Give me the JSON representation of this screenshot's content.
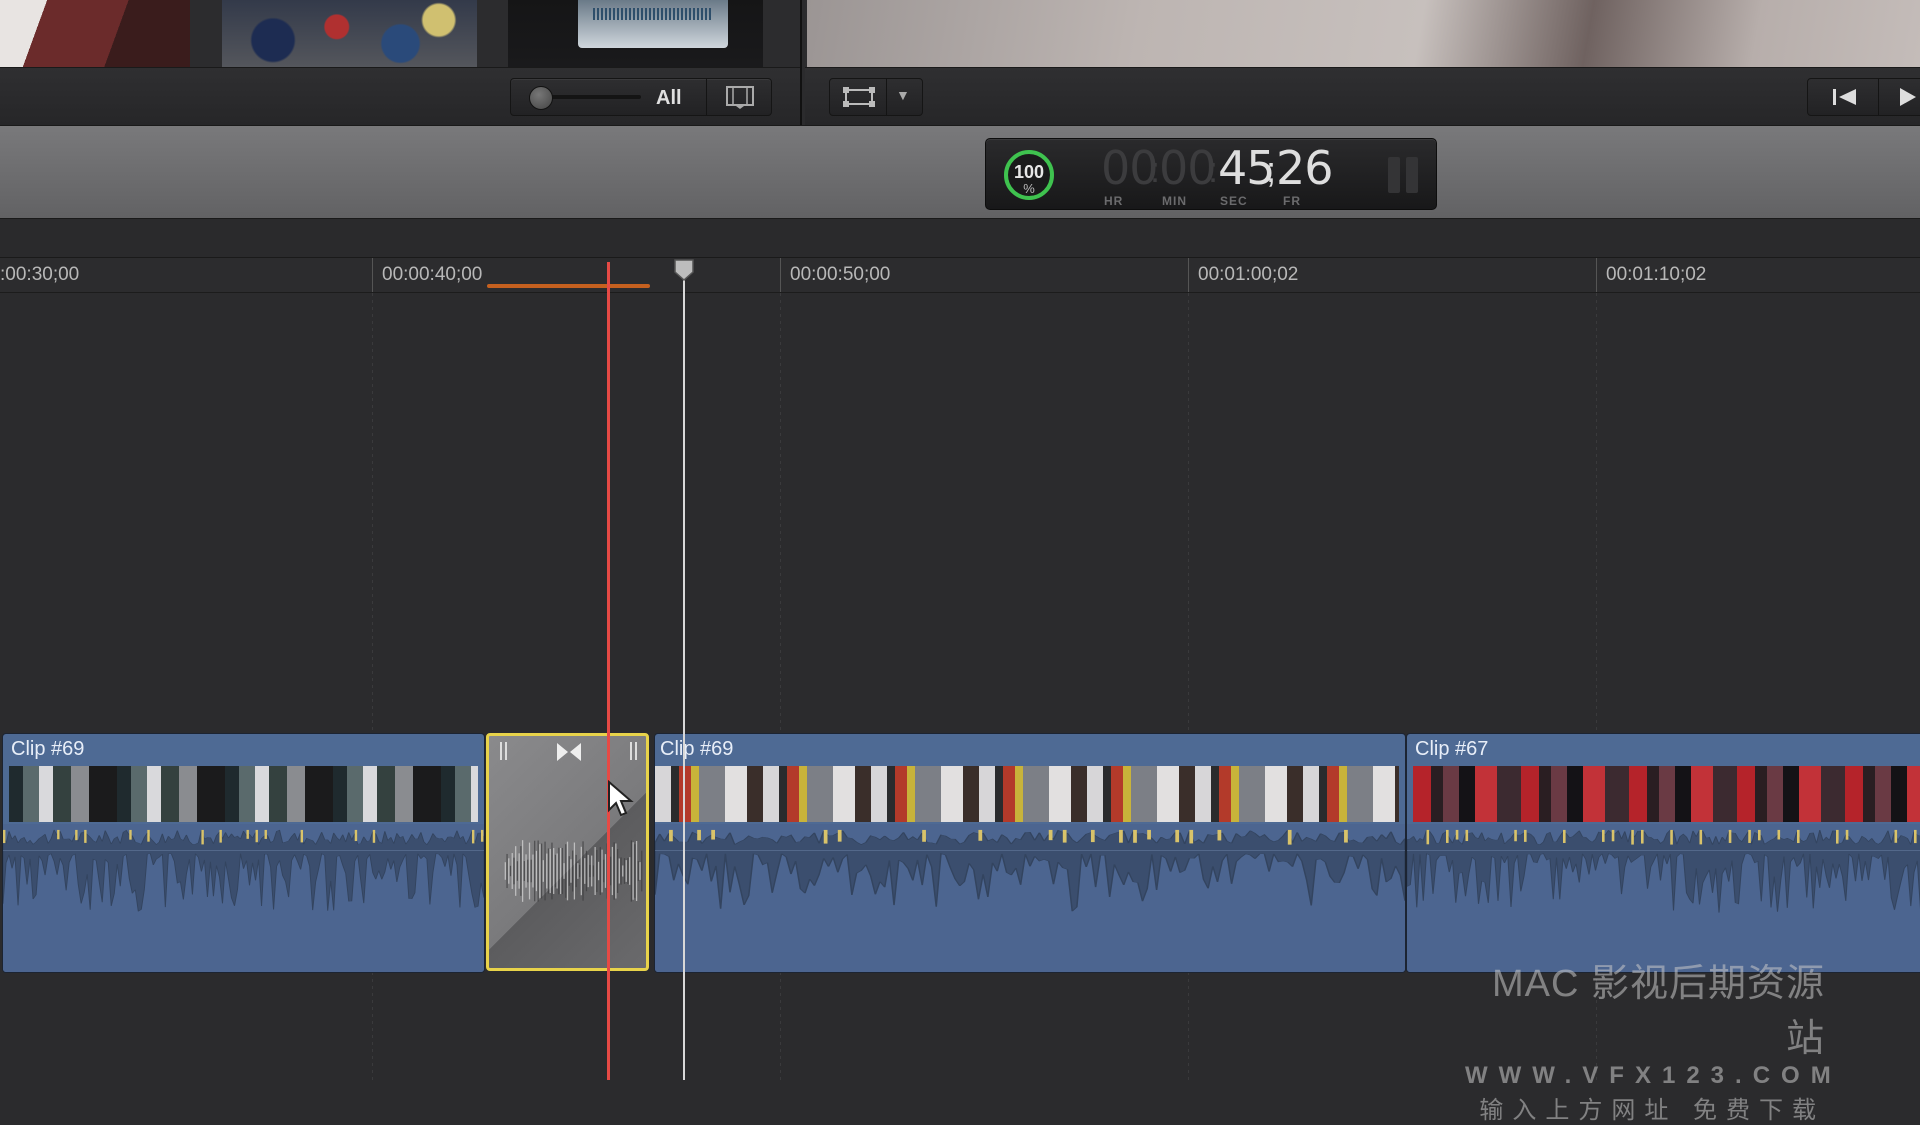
{
  "browser": {
    "zoom_filter_label": "All",
    "thumbnails": [
      "thumb-classroom-left",
      "thumb-classroom-students",
      "thumb-laptop-waveform"
    ]
  },
  "viewer": {
    "transform_menu_symbol": "▼"
  },
  "dashboard": {
    "progress_value": "100",
    "progress_unit": "%",
    "progress_fraction": 1.0,
    "timecode": {
      "hr": "00",
      "min": "00",
      "sec": "45",
      "fr": "26",
      "sep_hm": ":",
      "sep_ms": ":",
      "sep_sf": ";"
    },
    "units": {
      "hr": "HR",
      "min": "MIN",
      "sec": "SEC",
      "fr": "FR"
    }
  },
  "ruler": {
    "labels": [
      ":00:30;00",
      "00:00:40;00",
      "00:00:50;00",
      "00:01:00;02",
      "00:01:10;02"
    ]
  },
  "clips": [
    {
      "title": "Clip #69"
    },
    {
      "title": "Clip #69"
    },
    {
      "title": "Clip #67"
    }
  ],
  "watermark": {
    "line1": "MAC 影视后期资源站",
    "line2": "WWW.VFX123.COM",
    "line3": "输入上方网址 免费下载"
  },
  "colors": {
    "clip_blue": "#4e6a94",
    "transition_border": "#e8d34a",
    "skimmer": "#e64a45",
    "range_orange": "#c5601f",
    "audio_peak": "#d9c36a"
  },
  "icons": [
    "filmstrip-icon",
    "transform-icon",
    "chevron-down-icon",
    "skip-back-icon",
    "play-icon",
    "transition-bowtie-icon",
    "pointer-cursor-icon"
  ]
}
